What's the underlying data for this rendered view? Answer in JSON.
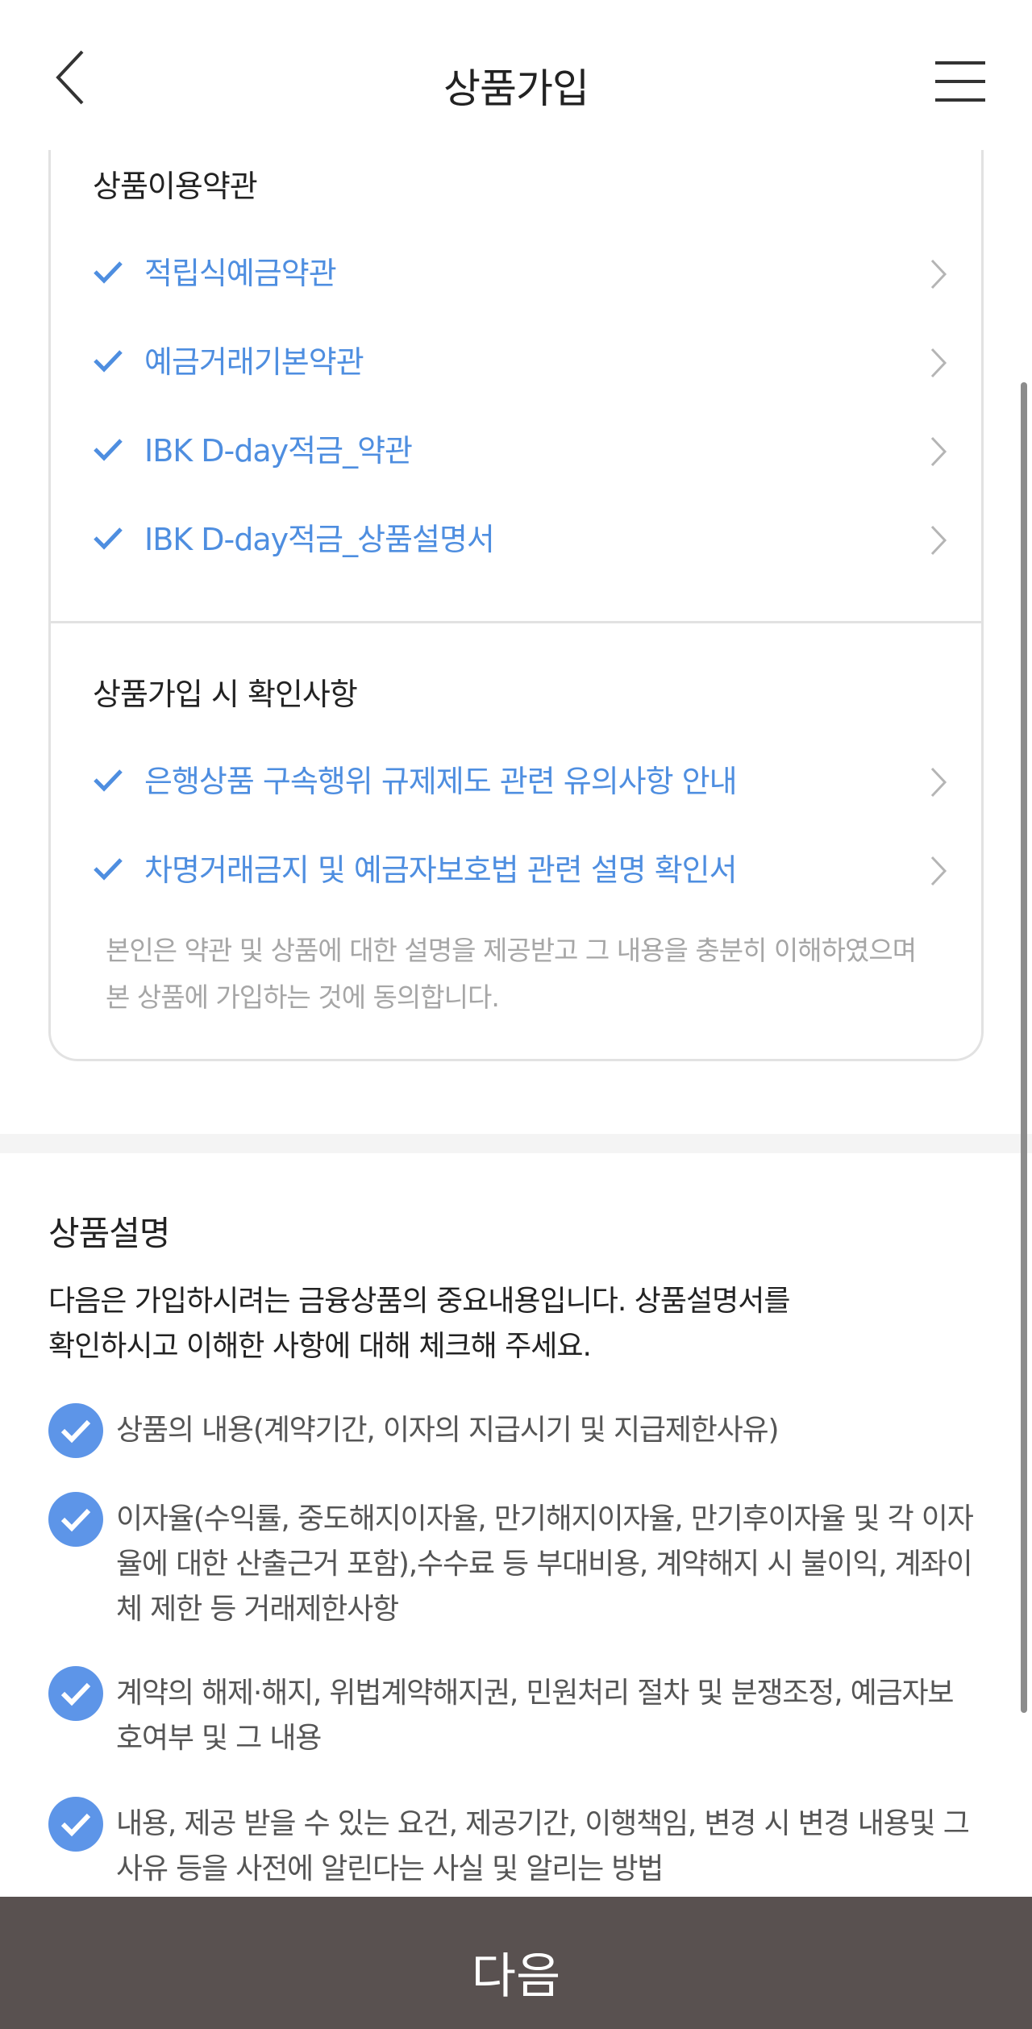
{
  "header": {
    "title": "상품가입",
    "back": "back",
    "menu": "menu"
  },
  "terms": {
    "heading": "상품이용약관",
    "items": [
      "적립식예금약관",
      "예금거래기본약관",
      "IBK D-day적금_약관",
      "IBK D-day적금_상품설명서"
    ]
  },
  "confirm": {
    "heading": "상품가입 시 확인사항",
    "items": [
      "은행상품 구속행위 규제제도 관련 유의사항 안내",
      "차명거래금지 및 예금자보호법 관련 설명 확인서"
    ],
    "consent_line1": "본인은 약관 및 상품에 대한 설명을 제공받고 그 내용을 충분히 이해하였으며",
    "consent_line2": "본 상품에 가입하는 것에 동의합니다."
  },
  "description": {
    "title": "상품설명",
    "intro_line1": "다음은 가입하시려는 금융상품의 중요내용입니다. 상품설명서를",
    "intro_line2": "확인하시고 이해한 사항에 대해 체크해 주세요.",
    "items": [
      {
        "lines": [
          "상품의 내용(계약기간, 이자의 지급시기 및 지급제한사유)"
        ]
      },
      {
        "lines": [
          "이자율(수익률, 중도해지이자율, 만기해지이자율, 만기후이자율 및 각 이자",
          "율에 대한 산출근거 포함),수수료 등 부대비용, 계약해지 시 불이익, 계좌이",
          "체 제한 등 거래제한사항"
        ]
      },
      {
        "lines": [
          "계약의 해제·해지, 위법계약해지권, 민원처리 절차 및 분쟁조정, 예금자보",
          "호여부 및 그 내용"
        ]
      },
      {
        "lines": [
          "내용, 제공 받을 수 있는 요건, 제공기간, 이행책임, 변경 시 변경 내용및 그",
          "사유 등을 사전에 알린다는 사실 및 알리는 방법"
        ]
      }
    ]
  },
  "footer": {
    "next_label": "다음"
  },
  "colors": {
    "accent": "#4e8ee0",
    "check_circle": "#5d95e8",
    "button_bg": "#595150"
  },
  "icons": [
    "back-arrow-icon",
    "hamburger-menu-icon",
    "check-icon",
    "chevron-right-icon",
    "check-circle-icon"
  ]
}
